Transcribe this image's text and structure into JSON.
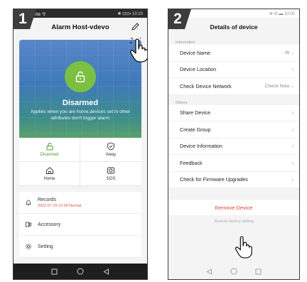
{
  "steps": {
    "one": "1",
    "two": "2"
  },
  "phone1": {
    "status_left": "M⊠ 令",
    "status_right": "✱ ⊡⊡▪ 10:23",
    "title": "Alarm Host-vdevo",
    "state": "Disarmed",
    "state_desc": "Applies when you are home,devices set in other attributes  don't trigger alarm",
    "modes": [
      {
        "label": "Disarmed",
        "icon": "unlock-icon",
        "active": true
      },
      {
        "label": "Away",
        "icon": "shield-check-icon",
        "active": false
      },
      {
        "label": "Home",
        "icon": "house-icon",
        "active": false
      },
      {
        "label": "SOS",
        "icon": "siren-icon",
        "active": false
      }
    ],
    "records_label": "Records",
    "records_sub": "2022-07-29 10:39 Normal",
    "accessory_label": "Accessory",
    "setting_label": "Setting"
  },
  "phone2": {
    "status_right": "⊛ ⊡ ▬ 10:02",
    "title": "Details of device",
    "section_info": "Information",
    "device_name_label": "Device Name",
    "device_name_value": "W",
    "device_location_label": "Device Location",
    "check_network_label": "Check Device Network",
    "check_network_value": "Check Now",
    "section_others": "Others",
    "share_label": "Share Device",
    "create_group_label": "Create Group",
    "device_info_label": "Device Information",
    "feedback_label": "Feedback",
    "firmware_label": "Check for Firmware Upgrades",
    "remove_label": "Remove Device",
    "restore_label": "Restore factory setting"
  },
  "colors": {
    "accent_green": "#7bc043",
    "danger": "#e0443b"
  }
}
